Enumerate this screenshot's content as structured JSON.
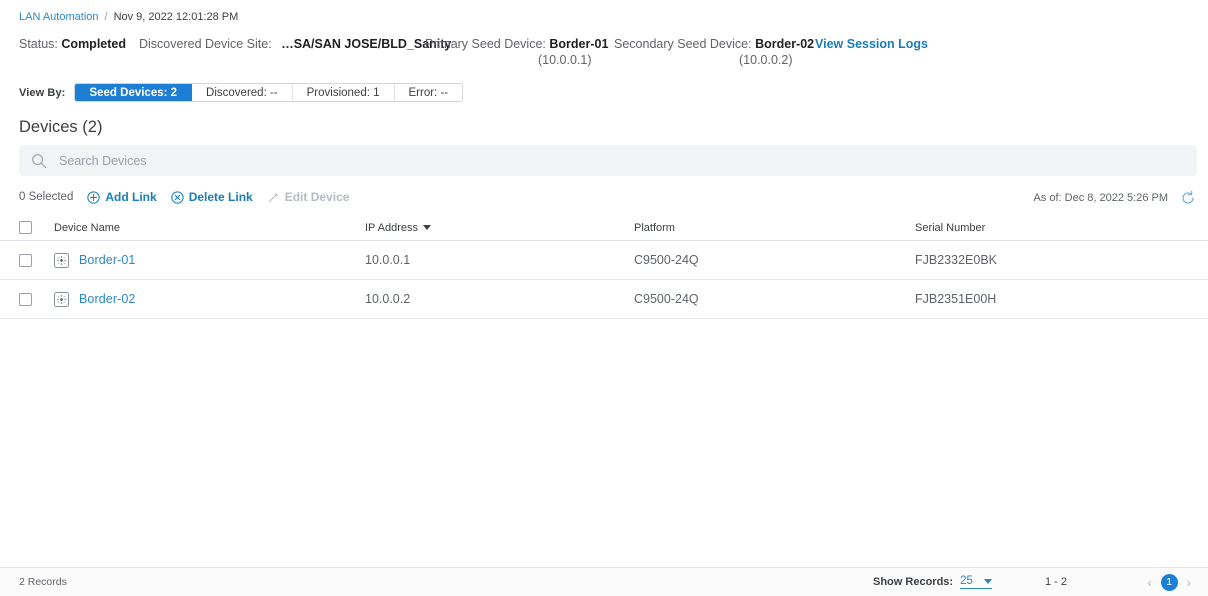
{
  "breadcrumb": {
    "root_label": "LAN Automation",
    "separator": "/",
    "current_label": "Nov 9, 2022 12:01:28 PM"
  },
  "summary": {
    "status_label": "Status:",
    "status_value": "Completed",
    "site_label": "Discovered Device Site:",
    "site_value": "…SA/SAN JOSE/BLD_Sanity",
    "primary_label": "Primary Seed Device:",
    "primary_value": "Border-01",
    "primary_ip": "(10.0.0.1)",
    "secondary_label": "Secondary Seed Device:",
    "secondary_value": "Border-02",
    "secondary_ip": "(10.0.0.2)",
    "session_logs_link": "View Session Logs"
  },
  "view_by": {
    "label": "View By:",
    "segments": [
      {
        "label": "Seed Devices: 2",
        "active": true
      },
      {
        "label": "Discovered: --",
        "active": false
      },
      {
        "label": "Provisioned: 1",
        "active": false
      },
      {
        "label": "Error: --",
        "active": false
      }
    ],
    "active_color": "#1c7fd4"
  },
  "devices": {
    "title": "Devices (2)",
    "search_placeholder": "Search Devices",
    "search_value": "",
    "search_icon": "search-icon"
  },
  "toolbar": {
    "selected_text": "0 Selected",
    "add_link_label": "Add Link",
    "add_link_icon": "plus-circle-icon",
    "delete_link_label": "Delete Link",
    "delete_link_icon": "close-circle-icon",
    "edit_device_label": "Edit Device",
    "edit_device_icon": "pencil-icon",
    "edit_device_disabled": true,
    "as_of_text": "As of: Dec 8, 2022 5:26 PM",
    "refresh_icon": "refresh-icon",
    "link_color": "#1b7db5",
    "disabled_color": "#b6bcc2"
  },
  "table": {
    "columns": [
      {
        "label": "Device Name",
        "sorted": false
      },
      {
        "label": "IP Address",
        "sorted": true,
        "sort_icon": "caret-down-icon"
      },
      {
        "label": "Platform",
        "sorted": false
      },
      {
        "label": "Serial Number",
        "sorted": false
      }
    ],
    "rows": [
      {
        "device_name": "Border-01",
        "ip_address": "10.0.0.1",
        "platform": "C9500-24Q",
        "serial_number": "FJB2332E0BK",
        "device_icon": "switch-icon",
        "selected": false
      },
      {
        "device_name": "Border-02",
        "ip_address": "10.0.0.2",
        "platform": "C9500-24Q",
        "serial_number": "FJB2351E00H",
        "device_icon": "switch-icon",
        "selected": false
      }
    ]
  },
  "footer": {
    "records_text": "2 Records",
    "show_records_label": "Show Records:",
    "show_records_value": "25",
    "range_text": "1 - 2",
    "prev_icon": "chevron-left-icon",
    "next_icon": "chevron-right-icon",
    "current_page": "1"
  }
}
